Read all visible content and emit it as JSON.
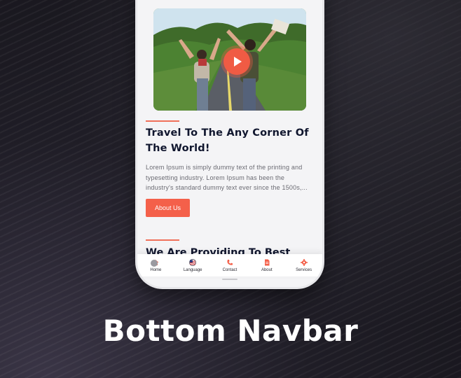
{
  "article": {
    "title": "Travel To The Any Corner Of The World!",
    "body": "Lorem Ipsum is simply dummy text of the printing and typesetting industry. Lorem Ipsum has been the industry's standard dummy text ever since the 1500s,...",
    "button_label": "About Us",
    "next_section_title": "We Are Providing To Best"
  },
  "bottom_nav": {
    "items": [
      {
        "label": "Home",
        "icon": "home-icon",
        "active": true
      },
      {
        "label": "Language",
        "icon": "flag-icon"
      },
      {
        "label": "Contact",
        "icon": "phone-icon"
      },
      {
        "label": "About",
        "icon": "document-icon"
      },
      {
        "label": "Services",
        "icon": "gear-icon"
      }
    ]
  },
  "caption": "Bottom Navbar",
  "colors": {
    "accent": "#f4604a",
    "heading": "#10162e",
    "background": "#17161b"
  }
}
